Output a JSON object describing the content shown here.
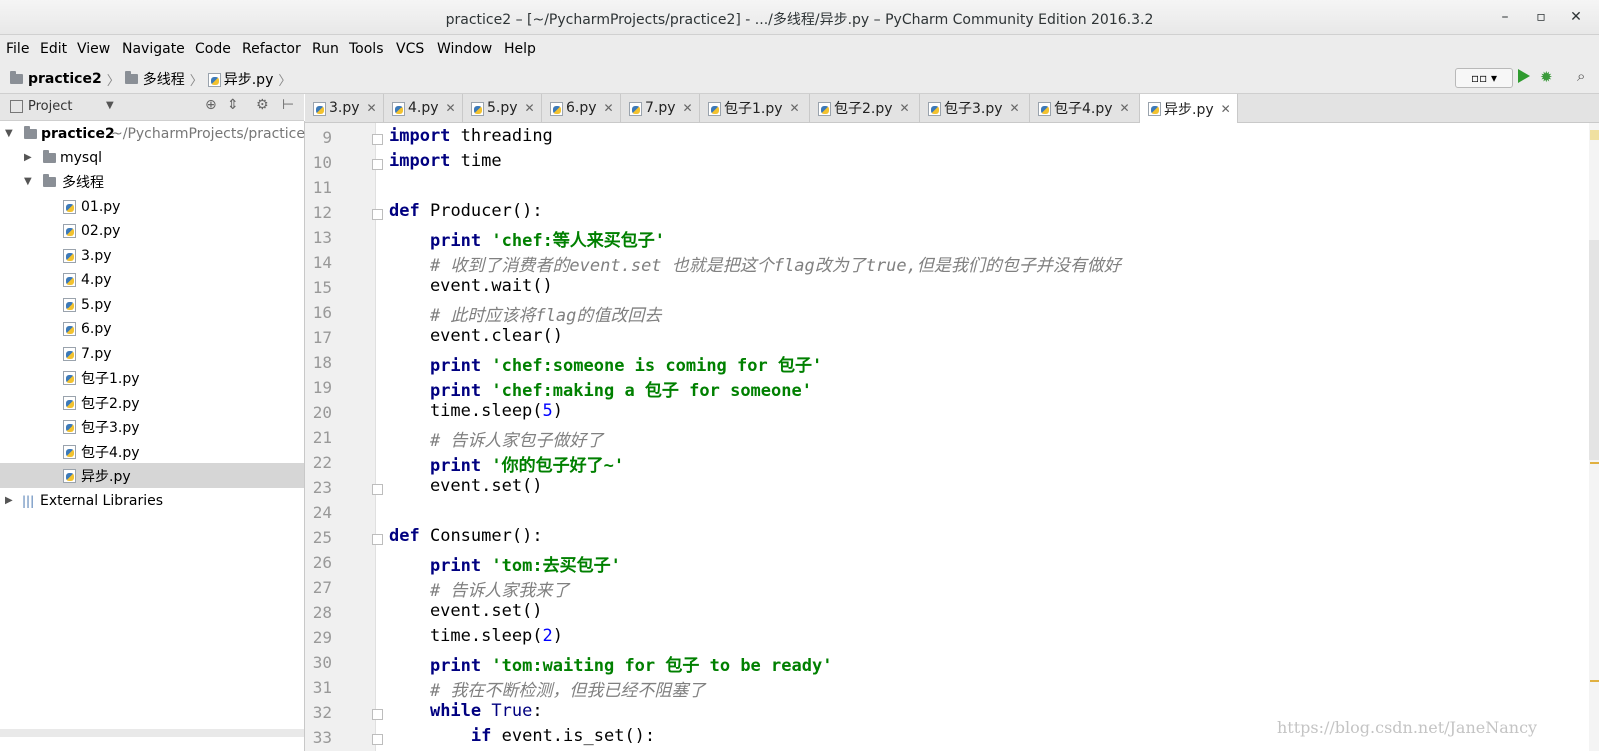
{
  "window": {
    "title": "practice2 – [~/PycharmProjects/practice2] - .../多线程/异步.py – PyCharm Community Edition 2016.3.2",
    "minimize": "–",
    "maximize": "▫",
    "close": "✕"
  },
  "menu": [
    "File",
    "Edit",
    "View",
    "Navigate",
    "Code",
    "Refactor",
    "Run",
    "Tools",
    "VCS",
    "Window",
    "Help"
  ],
  "breadcrumb": [
    "practice2",
    "多线程",
    "异步.py"
  ],
  "run_config": "▫▫ ▾",
  "project_pane": {
    "label": "Project",
    "root": {
      "name": "practice2",
      "path": "~/PycharmProjects/practice2"
    },
    "items": [
      {
        "name": "mysql",
        "type": "folder",
        "expanded": false
      },
      {
        "name": "多线程",
        "type": "folder",
        "expanded": true
      },
      {
        "name": "01.py",
        "type": "file"
      },
      {
        "name": "02.py",
        "type": "file"
      },
      {
        "name": "3.py",
        "type": "file"
      },
      {
        "name": "4.py",
        "type": "file"
      },
      {
        "name": "5.py",
        "type": "file"
      },
      {
        "name": "6.py",
        "type": "file"
      },
      {
        "name": "7.py",
        "type": "file"
      },
      {
        "name": "包子1.py",
        "type": "file"
      },
      {
        "name": "包子2.py",
        "type": "file"
      },
      {
        "name": "包子3.py",
        "type": "file"
      },
      {
        "name": "包子4.py",
        "type": "file"
      },
      {
        "name": "异步.py",
        "type": "file",
        "selected": true
      }
    ],
    "external": "External Libraries"
  },
  "tabs": [
    "3.py",
    "4.py",
    "5.py",
    "6.py",
    "7.py",
    "包子1.py",
    "包子2.py",
    "包子3.py",
    "包子4.py",
    "异步.py"
  ],
  "active_tab": "异步.py",
  "code_lines": [
    {
      "n": "9",
      "tokens": [
        [
          "kw",
          "import"
        ],
        [
          "",
          "threading"
        ]
      ]
    },
    {
      "n": "10",
      "tokens": [
        [
          "kw",
          "import"
        ],
        [
          "",
          "time"
        ]
      ]
    },
    {
      "n": "11",
      "tokens": []
    },
    {
      "n": "12",
      "tokens": [
        [
          "kw",
          "def"
        ],
        [
          "",
          "Producer():"
        ]
      ]
    },
    {
      "n": "13",
      "tokens": [
        [
          "",
          "    "
        ],
        [
          "kw",
          "print"
        ],
        [
          "str",
          "'chef:等人来买包子'"
        ]
      ]
    },
    {
      "n": "14",
      "tokens": [
        [
          "",
          "    "
        ],
        [
          "cm",
          "# 收到了消费者的event.set 也就是把这个flag改为了true,但是我们的包子并没有做好"
        ]
      ]
    },
    {
      "n": "15",
      "tokens": [
        [
          "",
          "    event.wait()"
        ]
      ]
    },
    {
      "n": "16",
      "tokens": [
        [
          "",
          "    "
        ],
        [
          "cm",
          "# 此时应该将flag的值改回去"
        ]
      ]
    },
    {
      "n": "17",
      "tokens": [
        [
          "",
          "    event.clear()"
        ]
      ]
    },
    {
      "n": "18",
      "tokens": [
        [
          "",
          "    "
        ],
        [
          "kw",
          "print"
        ],
        [
          "str",
          "'chef:someone is coming for 包子'"
        ]
      ]
    },
    {
      "n": "19",
      "tokens": [
        [
          "",
          "    "
        ],
        [
          "kw",
          "print"
        ],
        [
          "str",
          "'chef:making a 包子 for someone'"
        ]
      ]
    },
    {
      "n": "20",
      "tokens": [
        [
          "",
          "    time.sleep("
        ],
        [
          "num",
          "5"
        ],
        [
          "",
          ")"
        ]
      ]
    },
    {
      "n": "21",
      "tokens": [
        [
          "",
          "    "
        ],
        [
          "cm",
          "# 告诉人家包子做好了"
        ]
      ]
    },
    {
      "n": "22",
      "tokens": [
        [
          "",
          "    "
        ],
        [
          "kw",
          "print"
        ],
        [
          "str",
          "'你的包子好了~'"
        ]
      ]
    },
    {
      "n": "23",
      "tokens": [
        [
          "",
          "    event.set()"
        ]
      ]
    },
    {
      "n": "24",
      "tokens": []
    },
    {
      "n": "25",
      "tokens": [
        [
          "kw",
          "def"
        ],
        [
          "",
          "Consumer():"
        ]
      ]
    },
    {
      "n": "26",
      "tokens": [
        [
          "",
          "    "
        ],
        [
          "kw",
          "print"
        ],
        [
          "str",
          "'tom:去买包子'"
        ]
      ]
    },
    {
      "n": "27",
      "tokens": [
        [
          "",
          "    "
        ],
        [
          "cm",
          "# 告诉人家我来了"
        ]
      ]
    },
    {
      "n": "28",
      "tokens": [
        [
          "",
          "    event.set()"
        ]
      ]
    },
    {
      "n": "29",
      "tokens": [
        [
          "",
          "    time.sleep("
        ],
        [
          "num",
          "2"
        ],
        [
          "",
          ")"
        ]
      ]
    },
    {
      "n": "30",
      "tokens": [
        [
          "",
          "    "
        ],
        [
          "kw",
          "print"
        ],
        [
          "str",
          "'tom:waiting for 包子 to be ready'"
        ]
      ]
    },
    {
      "n": "31",
      "tokens": [
        [
          "",
          "    "
        ],
        [
          "cm",
          "# 我在不断检测，但我已经不阻塞了"
        ]
      ]
    },
    {
      "n": "32",
      "tokens": [
        [
          "",
          "    "
        ],
        [
          "kw",
          "while"
        ],
        [
          "bi",
          "True"
        ],
        [
          "",
          ":"
        ]
      ]
    },
    {
      "n": "33",
      "tokens": [
        [
          "",
          "        "
        ],
        [
          "kw",
          "if"
        ],
        [
          "",
          "event.is_set():"
        ]
      ]
    }
  ],
  "watermark": "https://blog.csdn.net/JaneNancy"
}
